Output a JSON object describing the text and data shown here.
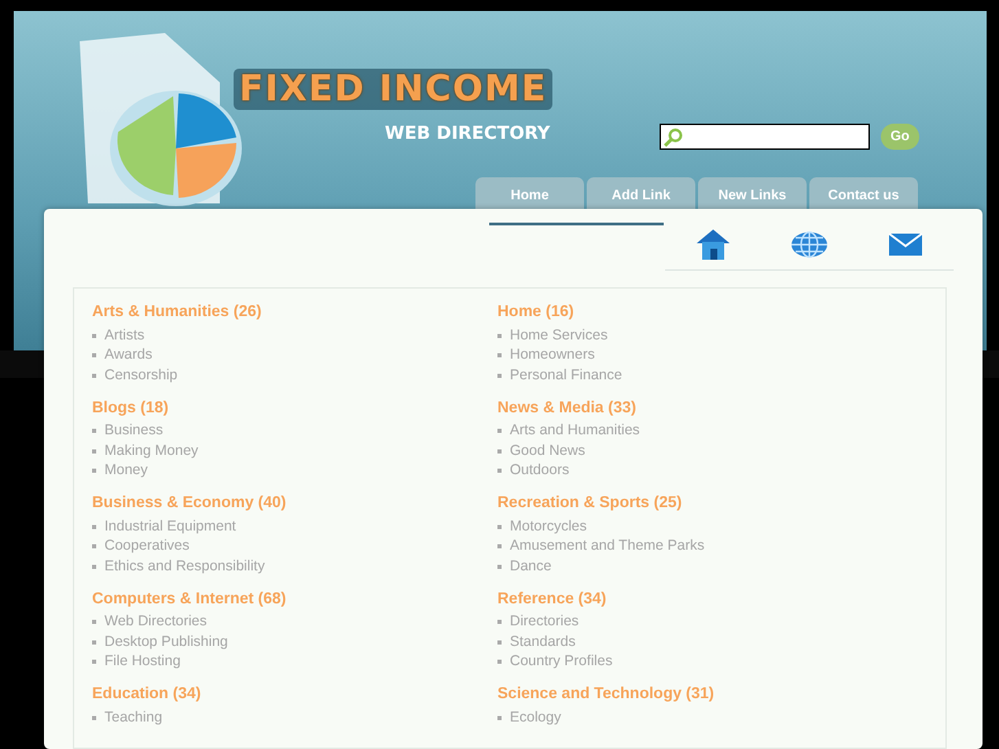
{
  "logo": {
    "title": "FIXED INCOME",
    "subtitle": "WEB DIRECTORY"
  },
  "search": {
    "button": "Go"
  },
  "nav": [
    {
      "label": "Home"
    },
    {
      "label": "Add Link"
    },
    {
      "label": "New Links"
    },
    {
      "label": "Contact us"
    }
  ],
  "quick_icons": [
    {
      "kind": "home"
    },
    {
      "kind": "globe"
    },
    {
      "kind": "mail"
    }
  ],
  "columns": [
    [
      {
        "title": "Arts & Humanities (26)",
        "links": [
          "Artists",
          "Awards",
          "Censorship"
        ]
      },
      {
        "title": "Blogs (18)",
        "links": [
          "Business",
          "Making Money",
          "Money"
        ]
      },
      {
        "title": "Business & Economy (40)",
        "links": [
          "Industrial Equipment",
          "Cooperatives",
          "Ethics and Responsibility"
        ]
      },
      {
        "title": "Computers & Internet (68)",
        "links": [
          "Web Directories",
          "Desktop Publishing",
          "File Hosting"
        ]
      },
      {
        "title": "Education (34)",
        "links": [
          "Teaching"
        ]
      }
    ],
    [
      {
        "title": "Home (16)",
        "links": [
          "Home Services",
          "Homeowners",
          "Personal Finance"
        ]
      },
      {
        "title": "News & Media (33)",
        "links": [
          "Arts and Humanities",
          "Good News",
          "Outdoors"
        ]
      },
      {
        "title": "Recreation & Sports (25)",
        "links": [
          "Motorcycles",
          "Amusement and Theme Parks",
          "Dance"
        ]
      },
      {
        "title": "Reference (34)",
        "links": [
          "Directories",
          "Standards",
          "Country Profiles"
        ]
      },
      {
        "title": "Science and Technology (31)",
        "links": [
          "Ecology"
        ]
      }
    ]
  ]
}
